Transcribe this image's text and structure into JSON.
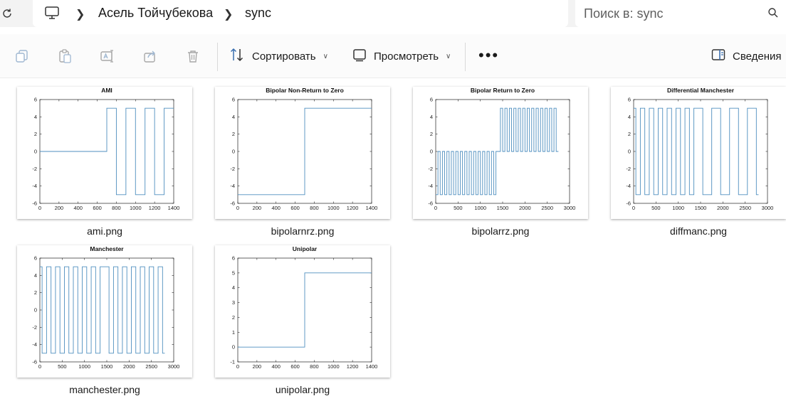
{
  "address_bar": {
    "crumbs": [
      "Асель Тойчубекова",
      "sync"
    ]
  },
  "search": {
    "placeholder": "Поиск в: sync"
  },
  "toolbar": {
    "sort_label": "Сортировать",
    "view_label": "Просмотреть",
    "more_label": "•••",
    "details_label": "Сведения"
  },
  "files": [
    {
      "name": "ami.png"
    },
    {
      "name": "bipolarnrz.png"
    },
    {
      "name": "bipolarrz.png"
    },
    {
      "name": "diffmanc.png"
    },
    {
      "name": "manchester.png"
    },
    {
      "name": "unipolar.png"
    }
  ],
  "chart_data": [
    {
      "type": "line",
      "title": "AMI",
      "xlim": [
        0,
        1400
      ],
      "ylim": [
        -6,
        6
      ],
      "xticks": [
        0,
        200,
        400,
        600,
        800,
        1000,
        1200,
        1400
      ],
      "yticks": [
        6,
        4,
        2,
        0,
        -2,
        -4,
        -6
      ],
      "x": [
        0,
        700,
        700,
        800,
        800,
        900,
        900,
        1000,
        1000,
        1100,
        1100,
        1200,
        1200,
        1300,
        1300,
        1400
      ],
      "y": [
        0,
        0,
        5,
        5,
        -5,
        -5,
        5,
        5,
        -5,
        -5,
        5,
        5,
        -5,
        -5,
        5,
        5
      ],
      "line_color": "#4f8fbf"
    },
    {
      "type": "line",
      "title": "Bipolar Non-Return to Zero",
      "xlim": [
        0,
        1400
      ],
      "ylim": [
        -6,
        6
      ],
      "xticks": [
        0,
        200,
        400,
        600,
        800,
        1000,
        1200,
        1400
      ],
      "yticks": [
        6,
        4,
        2,
        0,
        -2,
        -4,
        -6
      ],
      "x": [
        0,
        700,
        700,
        1400
      ],
      "y": [
        -5,
        -5,
        5,
        5
      ],
      "line_color": "#4f8fbf"
    },
    {
      "type": "line",
      "title": "Bipolar Return to Zero",
      "xlim": [
        0,
        3000
      ],
      "ylim": [
        -6,
        6
      ],
      "xticks": [
        0,
        500,
        1000,
        1500,
        2000,
        2500,
        3000
      ],
      "yticks": [
        6,
        4,
        2,
        0,
        -2,
        -4,
        -6
      ],
      "x": [
        0,
        50,
        50,
        100,
        100,
        150,
        150,
        200,
        200,
        250,
        250,
        300,
        300,
        350,
        350,
        400,
        400,
        450,
        450,
        500,
        500,
        550,
        550,
        600,
        600,
        650,
        650,
        700,
        700,
        750,
        750,
        800,
        800,
        850,
        850,
        900,
        900,
        950,
        950,
        1000,
        1000,
        1050,
        1050,
        1100,
        1100,
        1150,
        1150,
        1200,
        1200,
        1250,
        1250,
        1300,
        1300,
        1350,
        1350,
        1400,
        1400,
        1450,
        1450,
        1500,
        1500,
        1550,
        1550,
        1600,
        1600,
        1650,
        1650,
        1700,
        1700,
        1750,
        1750,
        1800,
        1800,
        1850,
        1850,
        1900,
        1900,
        1950,
        1950,
        2000,
        2000,
        2050,
        2050,
        2100,
        2100,
        2150,
        2150,
        2200,
        2200,
        2250,
        2250,
        2300,
        2300,
        2350,
        2350,
        2400,
        2400,
        2450,
        2450,
        2500,
        2500,
        2550,
        2550,
        2600,
        2600,
        2650,
        2650,
        2700,
        2700,
        2750,
        2750,
        2800
      ],
      "y": [
        -5,
        -5,
        0,
        0,
        -5,
        -5,
        0,
        0,
        -5,
        -5,
        0,
        0,
        -5,
        -5,
        0,
        0,
        -5,
        -5,
        0,
        0,
        -5,
        -5,
        0,
        0,
        -5,
        -5,
        0,
        0,
        -5,
        -5,
        0,
        0,
        -5,
        -5,
        0,
        0,
        -5,
        -5,
        0,
        0,
        -5,
        -5,
        0,
        0,
        -5,
        -5,
        0,
        0,
        -5,
        -5,
        0,
        0,
        -5,
        -5,
        0,
        0,
        0,
        0,
        5,
        5,
        0,
        0,
        5,
        5,
        0,
        0,
        5,
        5,
        0,
        0,
        5,
        5,
        0,
        0,
        5,
        5,
        0,
        0,
        5,
        5,
        0,
        0,
        5,
        5,
        0,
        0,
        5,
        5,
        0,
        0,
        5,
        5,
        0,
        0,
        5,
        5,
        0,
        0,
        5,
        5,
        0,
        0,
        5,
        5,
        0,
        0,
        5,
        5,
        0,
        0
      ],
      "line_color": "#4f8fbf"
    },
    {
      "type": "line",
      "title": "Differential Manchester",
      "xlim": [
        0,
        3000
      ],
      "ylim": [
        -6,
        6
      ],
      "xticks": [
        0,
        500,
        1000,
        1500,
        2000,
        2500,
        3000
      ],
      "yticks": [
        6,
        4,
        2,
        0,
        -2,
        -4,
        -6
      ],
      "x": [
        0,
        50,
        50,
        150,
        150,
        250,
        250,
        350,
        350,
        450,
        450,
        550,
        550,
        650,
        650,
        750,
        750,
        850,
        850,
        950,
        950,
        1050,
        1050,
        1150,
        1150,
        1250,
        1250,
        1350,
        1350,
        1550,
        1550,
        1750,
        1750,
        1950,
        1950,
        2150,
        2150,
        2350,
        2350,
        2550,
        2550,
        2750,
        2750,
        2800
      ],
      "y": [
        5,
        5,
        -5,
        -5,
        5,
        5,
        -5,
        -5,
        5,
        5,
        -5,
        -5,
        5,
        5,
        -5,
        -5,
        5,
        5,
        -5,
        -5,
        5,
        5,
        -5,
        -5,
        5,
        5,
        -5,
        -5,
        5,
        5,
        -5,
        -5,
        5,
        5,
        -5,
        -5,
        5,
        5,
        -5,
        -5,
        5,
        5,
        -5,
        -5
      ],
      "line_color": "#4f8fbf"
    },
    {
      "type": "line",
      "title": "Manchester",
      "xlim": [
        0,
        3000
      ],
      "ylim": [
        -6,
        6
      ],
      "xticks": [
        0,
        500,
        1000,
        1500,
        2000,
        2500,
        3000
      ],
      "yticks": [
        6,
        4,
        2,
        0,
        -2,
        -4,
        -6
      ],
      "x": [
        0,
        50,
        50,
        150,
        150,
        250,
        250,
        350,
        350,
        450,
        450,
        550,
        550,
        650,
        650,
        750,
        750,
        850,
        850,
        950,
        950,
        1050,
        1050,
        1150,
        1150,
        1250,
        1250,
        1350,
        1350,
        1550,
        1550,
        1650,
        1650,
        1750,
        1750,
        1850,
        1850,
        1950,
        1950,
        2050,
        2050,
        2150,
        2150,
        2250,
        2250,
        2350,
        2350,
        2450,
        2450,
        2550,
        2550,
        2650,
        2650,
        2750,
        2750,
        2800
      ],
      "y": [
        5,
        5,
        -5,
        -5,
        5,
        5,
        -5,
        -5,
        5,
        5,
        -5,
        -5,
        5,
        5,
        -5,
        -5,
        5,
        5,
        -5,
        -5,
        5,
        5,
        -5,
        -5,
        5,
        5,
        -5,
        -5,
        5,
        5,
        -5,
        -5,
        5,
        5,
        -5,
        -5,
        5,
        5,
        -5,
        -5,
        5,
        5,
        -5,
        -5,
        5,
        5,
        -5,
        -5,
        5,
        5,
        -5,
        -5,
        5,
        5,
        -5,
        -5
      ],
      "line_color": "#4f8fbf"
    },
    {
      "type": "line",
      "title": "Unipolar",
      "xlim": [
        0,
        1400
      ],
      "ylim": [
        -1,
        6
      ],
      "xticks": [
        0,
        200,
        400,
        600,
        800,
        1000,
        1200,
        1400
      ],
      "yticks": [
        6,
        5,
        4,
        3,
        2,
        1,
        0,
        -1
      ],
      "x": [
        0,
        700,
        700,
        1400
      ],
      "y": [
        0,
        0,
        5,
        5
      ],
      "line_color": "#4f8fbf"
    }
  ]
}
